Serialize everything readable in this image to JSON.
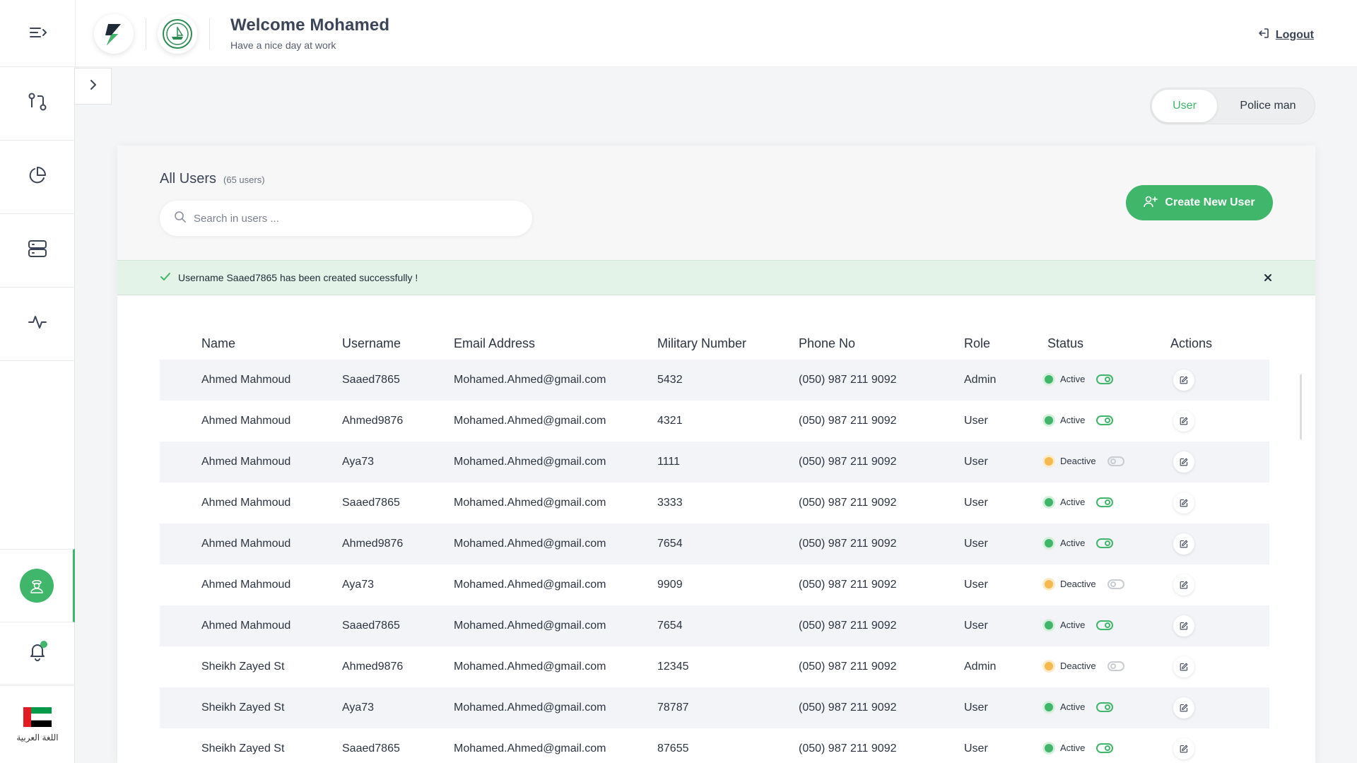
{
  "header": {
    "title": "Welcome Mohamed",
    "subtitle": "Have a nice day at work",
    "logout_label": "Logout"
  },
  "sidebar": {
    "items": [
      {
        "icon": "git-compare-icon"
      },
      {
        "icon": "pie-chart-icon"
      },
      {
        "icon": "server-icon"
      },
      {
        "icon": "activity-icon"
      },
      {
        "icon": "policeman-icon",
        "active": true
      },
      {
        "icon": "bell-icon",
        "badge": true
      }
    ],
    "language_label": "اللغة العربية"
  },
  "view_toggle": {
    "options": [
      "User",
      "Police man"
    ],
    "selected": "User"
  },
  "users": {
    "title": "All Users",
    "count_label": "(65 users)",
    "search_placeholder": "Search in users ...",
    "create_label": "Create New User"
  },
  "alert": {
    "message": "Username Saaed7865 has been created successfully !"
  },
  "table": {
    "columns": [
      "Name",
      "Username",
      "Email Address",
      "Military Number",
      "Phone No",
      "Role",
      "Status",
      "Actions"
    ],
    "rows": [
      {
        "name": "Ahmed Mahmoud",
        "username": "Saaed7865",
        "email": "Mohamed.Ahmed@gmail.com",
        "military": "5432",
        "phone": "(050) 987 211 9092",
        "role": "Admin",
        "status": "Active"
      },
      {
        "name": "Ahmed Mahmoud",
        "username": "Ahmed9876",
        "email": "Mohamed.Ahmed@gmail.com",
        "military": "4321",
        "phone": "(050) 987 211 9092",
        "role": "User",
        "status": "Active"
      },
      {
        "name": "Ahmed Mahmoud",
        "username": "Aya73",
        "email": "Mohamed.Ahmed@gmail.com",
        "military": "1111",
        "phone": "(050) 987 211 9092",
        "role": "User",
        "status": "Deactive"
      },
      {
        "name": "Ahmed Mahmoud",
        "username": "Saaed7865",
        "email": "Mohamed.Ahmed@gmail.com",
        "military": "3333",
        "phone": "(050) 987 211 9092",
        "role": "User",
        "status": "Active"
      },
      {
        "name": "Ahmed Mahmoud",
        "username": "Ahmed9876",
        "email": "Mohamed.Ahmed@gmail.com",
        "military": "7654",
        "phone": "(050) 987 211 9092",
        "role": "User",
        "status": "Active"
      },
      {
        "name": "Ahmed Mahmoud",
        "username": "Aya73",
        "email": "Mohamed.Ahmed@gmail.com",
        "military": "9909",
        "phone": "(050) 987 211 9092",
        "role": "User",
        "status": "Deactive"
      },
      {
        "name": "Ahmed Mahmoud",
        "username": "Saaed7865",
        "email": "Mohamed.Ahmed@gmail.com",
        "military": "7654",
        "phone": "(050) 987 211 9092",
        "role": "User",
        "status": "Active"
      },
      {
        "name": "Sheikh Zayed St",
        "username": "Ahmed9876",
        "email": "Mohamed.Ahmed@gmail.com",
        "military": "12345",
        "phone": "(050) 987 211 9092",
        "role": "Admin",
        "status": "Deactive"
      },
      {
        "name": "Sheikh Zayed St",
        "username": "Aya73",
        "email": "Mohamed.Ahmed@gmail.com",
        "military": "78787",
        "phone": "(050) 987 211 9092",
        "role": "User",
        "status": "Active"
      },
      {
        "name": "Sheikh Zayed St",
        "username": "Saaed7865",
        "email": "Mohamed.Ahmed@gmail.com",
        "military": "87655",
        "phone": "(050) 987 211 9092",
        "role": "User",
        "status": "Active"
      }
    ]
  },
  "colors": {
    "accent": "#3fb66a",
    "deactive": "#f5b94e",
    "alert_bg": "#e4f3e8"
  }
}
